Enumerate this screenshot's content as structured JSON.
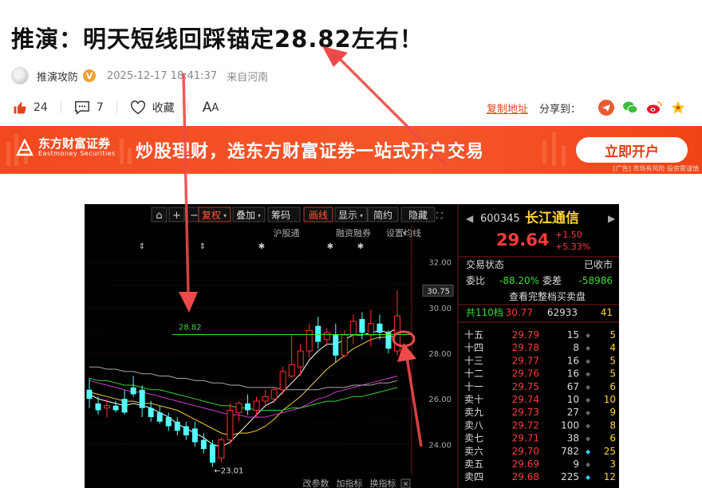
{
  "article": {
    "title": "推演：明天短线回踩锚定28.82左右！",
    "author": "推演攻防",
    "verified_badge": "V",
    "time": "2025-12-17 18:41:37",
    "location": "来自河南"
  },
  "actions": {
    "likes": "24",
    "comments": "7",
    "favorite_label": "收藏",
    "font_big": "A",
    "font_small": "A"
  },
  "share": {
    "copy_label": "复制地址",
    "share_label": "分享到："
  },
  "banner": {
    "logo_cn": "东方财富证券",
    "logo_en": "Eastmoney Securities",
    "slogan": "炒股理财，选东方财富证券一站式开户交易",
    "button": "立即开户",
    "note": "[广告] 市场有风险 投资需谨慎"
  },
  "toolbar": {
    "buttons": [
      "复权",
      "叠加",
      "筹码",
      "画线",
      "显示",
      "简约",
      "隐藏"
    ],
    "links": [
      "沪股通",
      "融资融券",
      "设置均线"
    ],
    "bottom": [
      "改参数",
      "加指标",
      "换指标"
    ]
  },
  "quote": {
    "code": "600345",
    "name": "长江通信",
    "price": "29.64",
    "change": "+1.50",
    "change_pct": "+5.33%",
    "status_label": "交易状态",
    "status": "已收市",
    "wb_label": "委比",
    "wb": "-88.20%",
    "wc_label": "委差",
    "wc": "-58986",
    "full_book": "查看完整档买卖盘",
    "total_label": "共110档",
    "total_price": "30.77",
    "total_vol": "62933",
    "total_n": "41",
    "book": [
      {
        "label": "十五",
        "price": "29.79",
        "vol": "15",
        "n": "5"
      },
      {
        "label": "十四",
        "price": "29.78",
        "vol": "8",
        "n": "4"
      },
      {
        "label": "十三",
        "price": "29.77",
        "vol": "16",
        "n": "5"
      },
      {
        "label": "十二",
        "price": "29.76",
        "vol": "16",
        "n": "5"
      },
      {
        "label": "十一",
        "price": "29.75",
        "vol": "67",
        "n": "6"
      },
      {
        "label": "卖十",
        "price": "29.74",
        "vol": "10",
        "n": "10"
      },
      {
        "label": "卖九",
        "price": "29.73",
        "vol": "27",
        "n": "9"
      },
      {
        "label": "卖八",
        "price": "29.72",
        "vol": "100",
        "n": "8"
      },
      {
        "label": "卖七",
        "price": "29.71",
        "vol": "38",
        "n": "6"
      },
      {
        "label": "卖六",
        "price": "29.70",
        "vol": "782",
        "n": "25"
      },
      {
        "label": "卖五",
        "price": "29.69",
        "vol": "9",
        "n": "3"
      },
      {
        "label": "卖四",
        "price": "29.68",
        "vol": "225",
        "n": "12"
      }
    ]
  },
  "chart_data": {
    "type": "candlestick",
    "y_ticks": [
      "32.00",
      "30.00",
      "28.00",
      "26.00",
      "24.00"
    ],
    "last_label": "30.75",
    "ylim": [
      23.0,
      33.0
    ],
    "support_line": 28.82,
    "support_label": "28.82",
    "low_label": "23.01",
    "candles": [
      {
        "o": 26.4,
        "h": 26.9,
        "l": 25.6,
        "c": 26.0
      },
      {
        "o": 25.8,
        "h": 26.1,
        "l": 25.3,
        "c": 25.5
      },
      {
        "o": 25.6,
        "h": 26.0,
        "l": 25.2,
        "c": 25.7
      },
      {
        "o": 25.7,
        "h": 25.9,
        "l": 25.4,
        "c": 25.5
      },
      {
        "o": 26.0,
        "h": 26.4,
        "l": 25.3,
        "c": 25.4
      },
      {
        "o": 26.5,
        "h": 27.0,
        "l": 26.1,
        "c": 26.2
      },
      {
        "o": 26.4,
        "h": 26.6,
        "l": 25.2,
        "c": 25.6
      },
      {
        "o": 25.6,
        "h": 25.9,
        "l": 25.0,
        "c": 25.2
      },
      {
        "o": 25.4,
        "h": 25.7,
        "l": 24.9,
        "c": 25.0
      },
      {
        "o": 25.2,
        "h": 25.4,
        "l": 24.6,
        "c": 24.8
      },
      {
        "o": 25.0,
        "h": 25.2,
        "l": 24.4,
        "c": 24.6
      },
      {
        "o": 24.8,
        "h": 25.0,
        "l": 24.2,
        "c": 24.4
      },
      {
        "o": 24.7,
        "h": 25.0,
        "l": 23.9,
        "c": 24.1
      },
      {
        "o": 24.2,
        "h": 24.5,
        "l": 23.6,
        "c": 23.8
      },
      {
        "o": 24.0,
        "h": 24.2,
        "l": 23.01,
        "c": 23.2
      },
      {
        "o": 23.4,
        "h": 24.3,
        "l": 23.2,
        "c": 24.2
      },
      {
        "o": 24.2,
        "h": 25.8,
        "l": 24.0,
        "c": 25.5
      },
      {
        "o": 25.4,
        "h": 25.9,
        "l": 25.0,
        "c": 25.8
      },
      {
        "o": 25.8,
        "h": 26.2,
        "l": 25.3,
        "c": 25.5
      },
      {
        "o": 25.5,
        "h": 26.1,
        "l": 25.2,
        "c": 25.9
      },
      {
        "o": 25.9,
        "h": 26.4,
        "l": 25.6,
        "c": 26.1
      },
      {
        "o": 26.0,
        "h": 26.5,
        "l": 25.8,
        "c": 26.4
      },
      {
        "o": 26.4,
        "h": 27.4,
        "l": 26.2,
        "c": 27.2
      },
      {
        "o": 27.0,
        "h": 28.8,
        "l": 26.9,
        "c": 27.5
      },
      {
        "o": 27.4,
        "h": 28.4,
        "l": 27.0,
        "c": 28.1
      },
      {
        "o": 28.1,
        "h": 29.3,
        "l": 27.8,
        "c": 29.0
      },
      {
        "o": 29.2,
        "h": 29.6,
        "l": 28.2,
        "c": 28.5
      },
      {
        "o": 28.6,
        "h": 29.1,
        "l": 28.3,
        "c": 28.9
      },
      {
        "o": 28.8,
        "h": 29.3,
        "l": 27.6,
        "c": 27.9
      },
      {
        "o": 27.9,
        "h": 29.0,
        "l": 27.8,
        "c": 28.8
      },
      {
        "o": 28.8,
        "h": 29.7,
        "l": 28.4,
        "c": 29.4
      },
      {
        "o": 29.5,
        "h": 29.8,
        "l": 28.6,
        "c": 28.9
      },
      {
        "o": 28.8,
        "h": 29.9,
        "l": 28.3,
        "c": 29.3
      },
      {
        "o": 29.3,
        "h": 29.7,
        "l": 28.6,
        "c": 28.9
      },
      {
        "o": 28.9,
        "h": 29.0,
        "l": 28.0,
        "c": 28.2
      },
      {
        "o": 28.1,
        "h": 30.75,
        "l": 27.9,
        "c": 29.64
      }
    ],
    "ma": [
      {
        "name": "MA5",
        "color": "#ffffff",
        "values": [
          26.2,
          26.0,
          25.9,
          25.8,
          25.7,
          25.8,
          25.7,
          25.6,
          25.4,
          25.2,
          24.9,
          24.7,
          24.5,
          24.3,
          24.0,
          23.9,
          24.1,
          24.5,
          24.9,
          25.3,
          25.7,
          25.9,
          26.3,
          26.7,
          27.1,
          27.7,
          28.1,
          28.4,
          28.4,
          28.6,
          28.8,
          28.8,
          28.9,
          29.0,
          28.9,
          29.1
        ]
      },
      {
        "name": "MA10",
        "color": "#f5d23a",
        "values": [
          26.3,
          26.2,
          26.1,
          26.0,
          25.9,
          25.9,
          25.8,
          25.8,
          25.7,
          25.6,
          25.5,
          25.3,
          25.1,
          24.9,
          24.7,
          24.5,
          24.4,
          24.5,
          24.5,
          24.6,
          24.8,
          25.1,
          25.5,
          25.8,
          26.1,
          26.5,
          26.9,
          27.3,
          27.6,
          27.9,
          28.2,
          28.4,
          28.6,
          28.7,
          28.7,
          28.8
        ]
      },
      {
        "name": "MA20",
        "color": "#d43ad4",
        "values": [
          26.8,
          26.7,
          26.6,
          26.5,
          26.4,
          26.3,
          26.3,
          26.2,
          26.1,
          26.0,
          25.9,
          25.8,
          25.7,
          25.6,
          25.5,
          25.4,
          25.3,
          25.3,
          25.2,
          25.2,
          25.2,
          25.3,
          25.4,
          25.5,
          25.6,
          25.8,
          26.0,
          26.1,
          26.3,
          26.4,
          26.5,
          26.6,
          26.7,
          26.8,
          26.9,
          27.0
        ]
      },
      {
        "name": "MA30",
        "color": "#3ad43a",
        "values": [
          26.9,
          26.8,
          26.8,
          26.7,
          26.6,
          26.6,
          26.5,
          26.4,
          26.4,
          26.3,
          26.2,
          26.1,
          26.0,
          25.9,
          25.8,
          25.7,
          25.7,
          25.6,
          25.6,
          25.5,
          25.5,
          25.5,
          25.5,
          25.6,
          25.6,
          25.7,
          25.8,
          25.9,
          25.9,
          26.0,
          26.1,
          26.1,
          26.2,
          26.3,
          26.4,
          26.5
        ]
      },
      {
        "name": "MA60",
        "color": "#aaaaaa",
        "values": [
          27.4,
          27.4,
          27.3,
          27.3,
          27.2,
          27.2,
          27.1,
          27.1,
          27.0,
          27.0,
          26.9,
          26.9,
          26.8,
          26.8,
          26.7,
          26.7,
          26.6,
          26.6,
          26.5,
          26.5,
          26.5,
          26.5,
          26.4,
          26.4,
          26.4,
          26.4,
          26.4,
          26.5,
          26.5,
          26.5,
          26.6,
          26.6,
          26.6,
          26.7,
          26.7,
          26.8
        ]
      }
    ]
  },
  "colors": {
    "up": "#ff3232",
    "down": "#54fcfc",
    "accent": "#e3461b"
  }
}
